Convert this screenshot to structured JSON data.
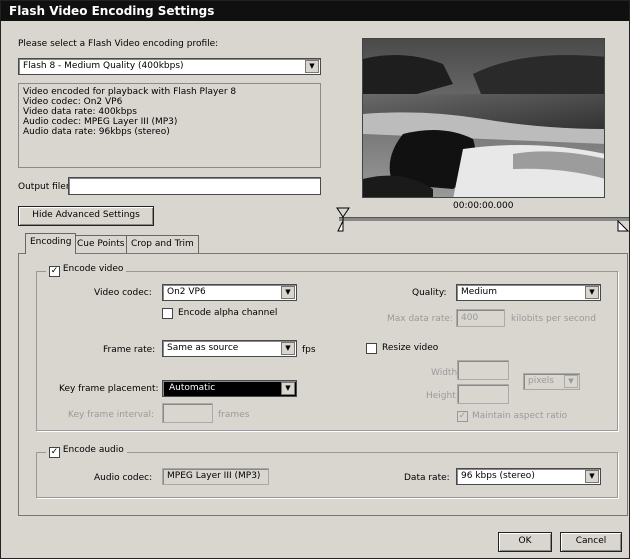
{
  "window": {
    "title": "Flash Video Encoding Settings"
  },
  "profile": {
    "prompt": "Please select a Flash Video encoding profile:",
    "selected": "Flash 8 - Medium Quality (400kbps)",
    "info": [
      "Video encoded for playback with Flash Player 8",
      "Video codec: On2 VP6",
      "Video data rate: 400kbps",
      "Audio codec: MPEG Layer III (MP3)",
      "Audio data rate: 96kbps (stereo)"
    ]
  },
  "output": {
    "label": "Output filename:",
    "value": ""
  },
  "advanced_button": "Hide Advanced Settings",
  "preview": {
    "timecode": "00:00:00.000"
  },
  "tabs": [
    {
      "label": "Encoding",
      "active": true
    },
    {
      "label": "Cue Points",
      "active": false
    },
    {
      "label": "Crop and Trim",
      "active": false
    }
  ],
  "encoding": {
    "encode_video": {
      "label": "Encode video",
      "checked": true
    },
    "video_codec": {
      "label": "Video codec:",
      "value": "On2 VP6"
    },
    "alpha": {
      "label": "Encode alpha channel",
      "checked": false
    },
    "quality": {
      "label": "Quality:",
      "value": "Medium"
    },
    "max_rate": {
      "label": "Max data rate:",
      "value": "400",
      "unit": "kilobits per second"
    },
    "frame_rate": {
      "label": "Frame rate:",
      "value": "Same as source",
      "unit": "fps"
    },
    "resize": {
      "label": "Resize video",
      "checked": false
    },
    "width": {
      "label": "Width:",
      "value": ""
    },
    "height": {
      "label": "Height:",
      "value": ""
    },
    "size_unit": "pixels",
    "aspect": {
      "label": "Maintain aspect ratio",
      "checked": true
    },
    "keyframe_placement": {
      "label": "Key frame placement:",
      "value": "Automatic"
    },
    "keyframe_interval": {
      "label": "Key frame interval:",
      "value": "",
      "unit": "frames"
    },
    "encode_audio": {
      "label": "Encode audio",
      "checked": true
    },
    "audio_codec": {
      "label": "Audio codec:",
      "value": "MPEG Layer III (MP3)"
    },
    "data_rate": {
      "label": "Data rate:",
      "value": "96 kbps (stereo)"
    }
  },
  "buttons": {
    "ok": "OK",
    "cancel": "Cancel"
  }
}
